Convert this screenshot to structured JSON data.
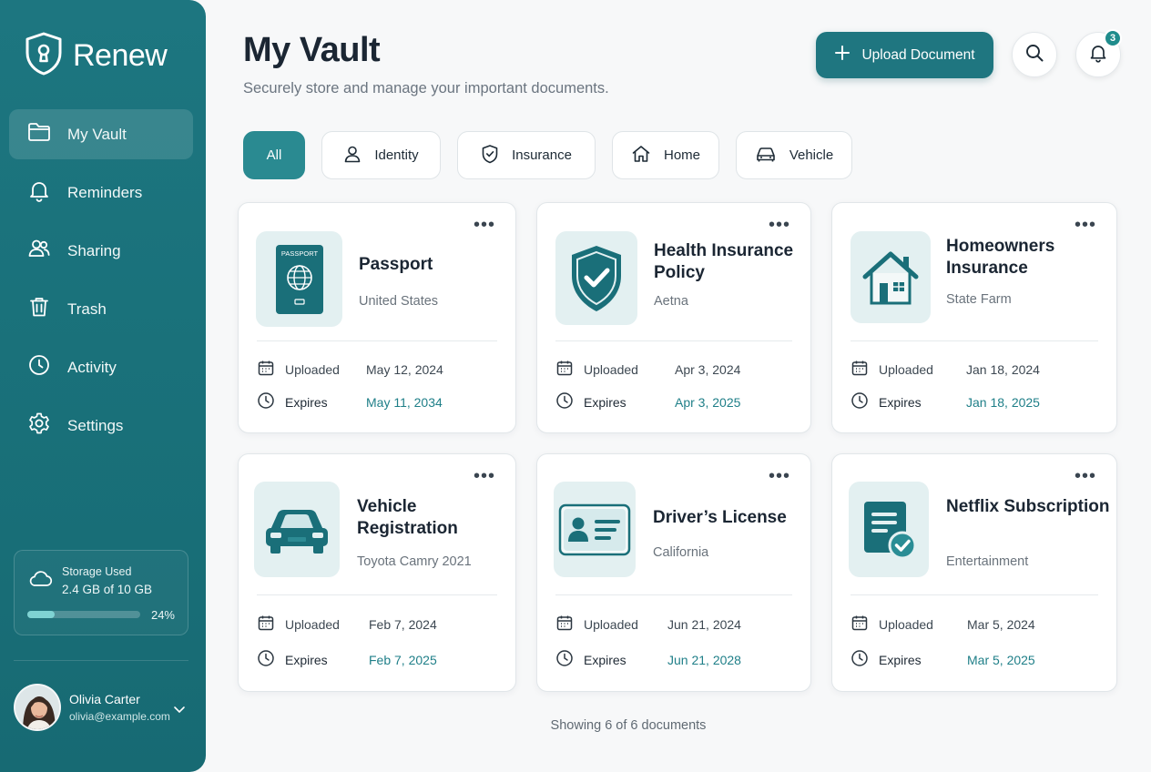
{
  "app": {
    "brand_name": "Renew"
  },
  "sidebar": {
    "items": [
      {
        "label": "My Vault",
        "icon": "folder-icon",
        "active": true
      },
      {
        "label": "Reminders",
        "icon": "bell-icon",
        "active": false
      },
      {
        "label": "Sharing",
        "icon": "users-icon",
        "active": false
      },
      {
        "label": "Trash",
        "icon": "trash-icon",
        "active": false
      },
      {
        "label": "Activity",
        "icon": "clock-icon",
        "active": false
      },
      {
        "label": "Settings",
        "icon": "gear-icon",
        "active": false
      }
    ],
    "storage": {
      "title": "Storage Used",
      "amount": "2.4 GB of 10 GB",
      "percent_label": "24%",
      "percent": 24
    },
    "user": {
      "name": "Olivia Carter",
      "email": "olivia@example.com"
    }
  },
  "header": {
    "title": "My Vault",
    "subtitle": "Securely store and manage your important documents.",
    "upload_label": "Upload Document",
    "notification_count": "3"
  },
  "filters": [
    {
      "label": "All",
      "icon": "",
      "active": true
    },
    {
      "label": "Identity",
      "icon": "person-icon",
      "active": false
    },
    {
      "label": "Insurance",
      "icon": "shield-icon",
      "active": false
    },
    {
      "label": "Home",
      "icon": "home-icon",
      "active": false
    },
    {
      "label": "Vehicle",
      "icon": "car-icon",
      "active": false
    }
  ],
  "meta_labels": {
    "uploaded": "Uploaded",
    "expires": "Expires"
  },
  "documents": [
    {
      "title": "Passport",
      "subtitle": "United States",
      "uploaded": "May 12, 2024",
      "expires": "May 11, 2034",
      "icon": "passport-icon",
      "icon_text": "PASSPORT"
    },
    {
      "title": "Health Insurance Policy",
      "subtitle": "Aetna",
      "uploaded": "Apr 3, 2024",
      "expires": "Apr 3, 2025",
      "icon": "shield-check-icon"
    },
    {
      "title": "Homeowners Insurance",
      "subtitle": "State Farm",
      "uploaded": "Jan 18, 2024",
      "expires": "Jan 18, 2025",
      "icon": "house-icon"
    },
    {
      "title": "Vehicle Registration",
      "subtitle": "Toyota Camry 2021",
      "uploaded": "Feb 7, 2024",
      "expires": "Feb 7, 2025",
      "icon": "car-icon"
    },
    {
      "title": "Driver’s License",
      "subtitle": "California",
      "uploaded": "Jun 21, 2024",
      "expires": "Jun 21, 2028",
      "icon": "id-card-icon"
    },
    {
      "title": "Netflix Subscription",
      "subtitle": "Entertainment",
      "uploaded": "Mar 5, 2024",
      "expires": "Mar 5, 2025",
      "icon": "document-check-icon"
    }
  ],
  "footer": {
    "count_text": "Showing 6 of 6 documents"
  },
  "colors": {
    "primary": "#1f7680",
    "sidebar": "#197079",
    "accent_text": "#1f7f88",
    "icon_tile": "#e3f0f1"
  }
}
